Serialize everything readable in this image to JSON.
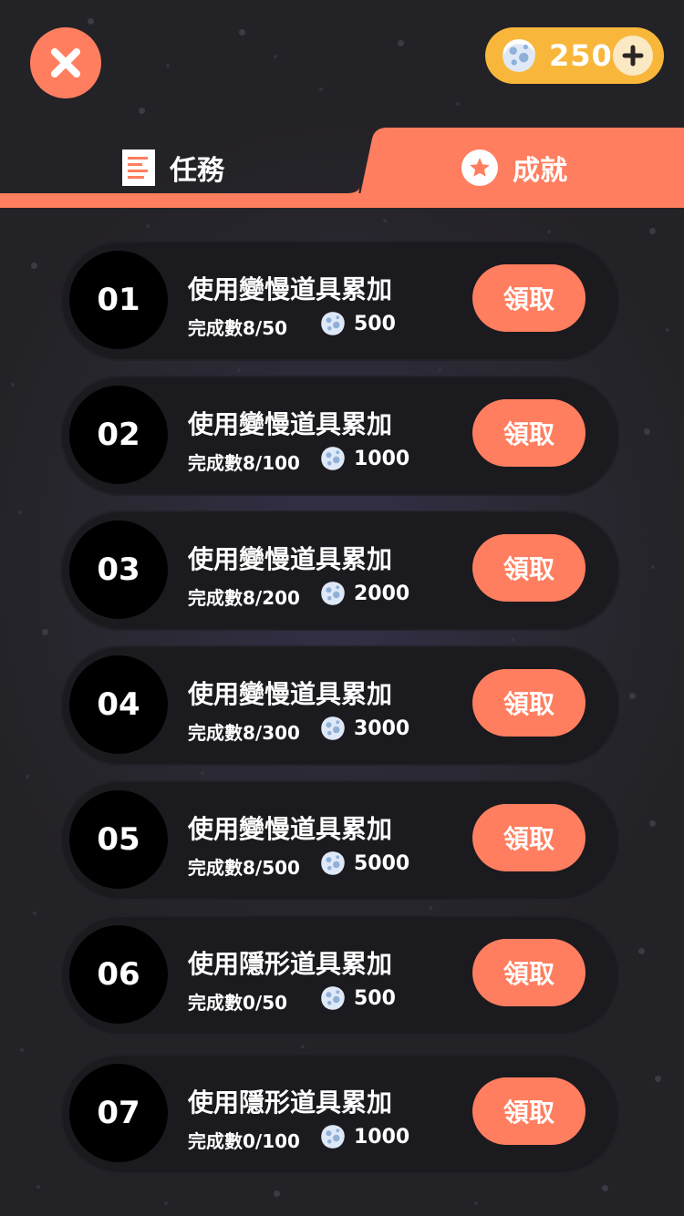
{
  "header": {
    "close_icon": "close-icon",
    "currency": {
      "icon": "asteroid-icon",
      "amount": "250",
      "add_icon": "plus-icon"
    }
  },
  "tabs": [
    {
      "label": "任務",
      "icon": "document-icon",
      "active": false
    },
    {
      "label": "成就",
      "icon": "star-icon",
      "active": true
    }
  ],
  "colors": {
    "accent": "#ff7e5f",
    "coin_pill": "#f8b73a",
    "row_bg": "#1b1a1e",
    "background": "#2a2832"
  },
  "achievements": [
    {
      "num": "01",
      "title": "使用變慢道具累加",
      "progress": "完成數8/50",
      "reward": "500",
      "button": "領取"
    },
    {
      "num": "02",
      "title": "使用變慢道具累加",
      "progress": "完成數8/100",
      "reward": "1000",
      "button": "領取"
    },
    {
      "num": "03",
      "title": "使用變慢道具累加",
      "progress": "完成數8/200",
      "reward": "2000",
      "button": "領取"
    },
    {
      "num": "04",
      "title": "使用變慢道具累加",
      "progress": "完成數8/300",
      "reward": "3000",
      "button": "領取"
    },
    {
      "num": "05",
      "title": "使用變慢道具累加",
      "progress": "完成數8/500",
      "reward": "5000",
      "button": "領取"
    },
    {
      "num": "06",
      "title": "使用隱形道具累加",
      "progress": "完成數0/50",
      "reward": "500",
      "button": "領取"
    },
    {
      "num": "07",
      "title": "使用隱形道具累加",
      "progress": "完成數0/100",
      "reward": "1000",
      "button": "領取"
    }
  ]
}
